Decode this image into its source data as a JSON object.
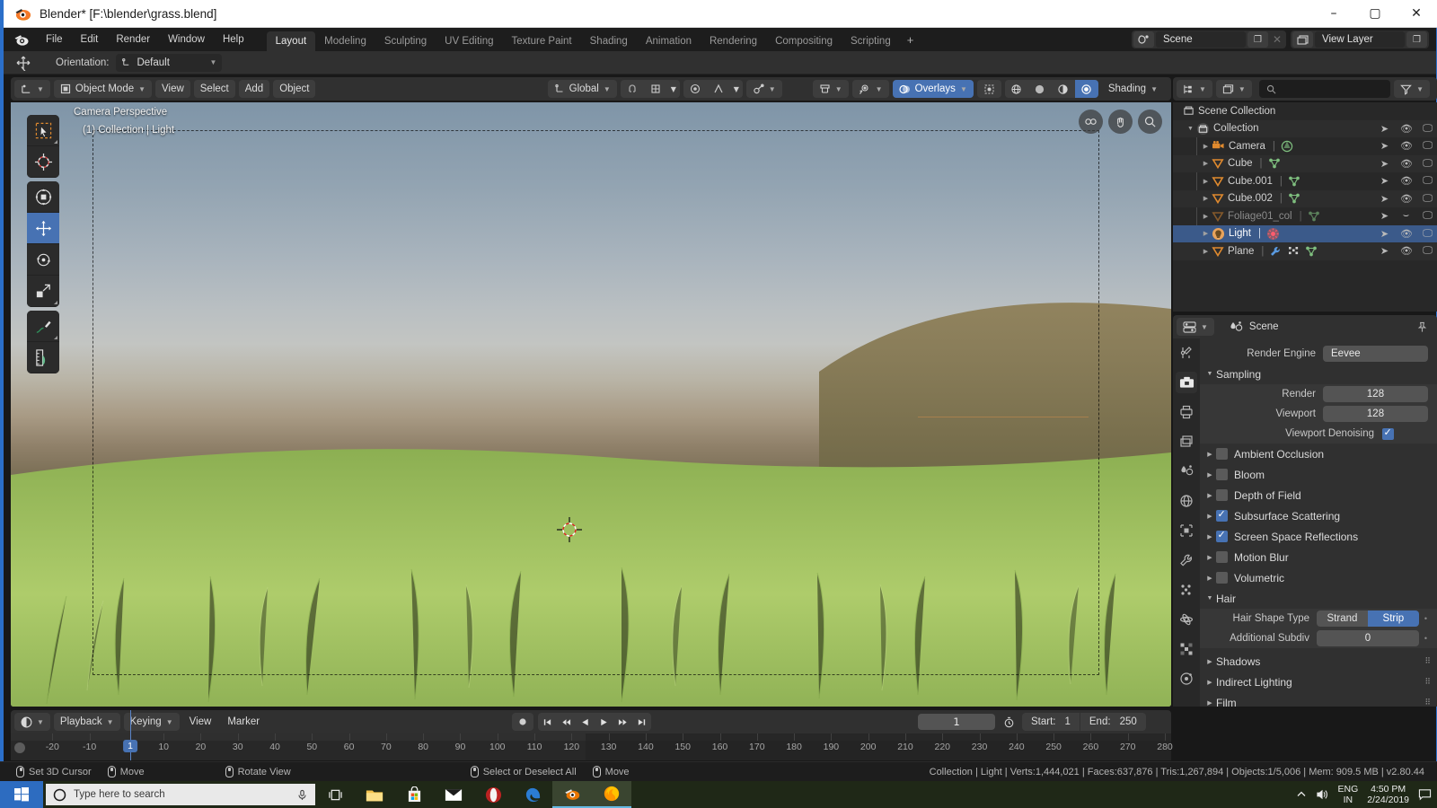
{
  "window": {
    "title": "Blender* [F:\\blender\\grass.blend]",
    "minimize": "–",
    "maximize": "▢",
    "close": "✕"
  },
  "topbar": {
    "app_icon": "blender-logo-icon",
    "menus": [
      "File",
      "Edit",
      "Render",
      "Window",
      "Help"
    ],
    "workspace_tabs": [
      {
        "label": "Layout",
        "active": true
      },
      {
        "label": "Modeling",
        "active": false
      },
      {
        "label": "Sculpting",
        "active": false
      },
      {
        "label": "UV Editing",
        "active": false
      },
      {
        "label": "Texture Paint",
        "active": false
      },
      {
        "label": "Shading",
        "active": false
      },
      {
        "label": "Animation",
        "active": false
      },
      {
        "label": "Rendering",
        "active": false
      },
      {
        "label": "Compositing",
        "active": false
      },
      {
        "label": "Scripting",
        "active": false
      },
      {
        "label": "+",
        "active": false
      }
    ],
    "scene_name": "Scene",
    "view_layer_name": "View Layer"
  },
  "tool_settings": {
    "orientation_label": "Orientation:",
    "orientation_value": "Default"
  },
  "viewport_header": {
    "mode": "Object Mode",
    "menus": [
      "View",
      "Select",
      "Add",
      "Object"
    ],
    "transform_orientation": "Global",
    "overlays": "Overlays",
    "shading": "Shading"
  },
  "viewport": {
    "label_line1": "Camera Perspective",
    "label_line2": "(1) Collection | Light",
    "tools": [
      "tweak-select-tool",
      "cursor-tool",
      "transform-tool",
      "move-tool",
      "rotate-tool",
      "scale-tool",
      "annotate-tool",
      "measure-tool"
    ],
    "gizmos": [
      "camera-gizmo",
      "hand-pan-gizmo",
      "zoom-gizmo"
    ]
  },
  "outliner": {
    "filter_icon": "filter-icon",
    "search_placeholder": "",
    "rows": [
      {
        "name": "Scene Collection",
        "icon": "collection-icon",
        "indent": 0,
        "disclose": "",
        "selected": false,
        "dim": false,
        "badges": []
      },
      {
        "name": "Collection",
        "icon": "collection-icon",
        "indent": 1,
        "disclose": "▼",
        "selected": false,
        "dim": false,
        "badges": []
      },
      {
        "name": "Camera",
        "icon": "camera-icon",
        "indent": 2,
        "disclose": "▶",
        "selected": false,
        "dim": false,
        "badges": [
          "camera-data-icon"
        ]
      },
      {
        "name": "Cube",
        "icon": "mesh-icon",
        "indent": 2,
        "disclose": "▶",
        "selected": false,
        "dim": false,
        "badges": [
          "mesh-data-icon"
        ]
      },
      {
        "name": "Cube.001",
        "icon": "mesh-icon",
        "indent": 2,
        "disclose": "▶",
        "selected": false,
        "dim": false,
        "badges": [
          "mesh-data-icon"
        ]
      },
      {
        "name": "Cube.002",
        "icon": "mesh-icon",
        "indent": 2,
        "disclose": "▶",
        "selected": false,
        "dim": false,
        "badges": [
          "mesh-data-icon"
        ]
      },
      {
        "name": "Foliage01_col",
        "icon": "mesh-icon",
        "indent": 2,
        "disclose": "▶",
        "selected": false,
        "dim": true,
        "badges": [
          "mesh-data-icon"
        ]
      },
      {
        "name": "Light",
        "icon": "light-icon",
        "indent": 2,
        "disclose": "▶",
        "selected": true,
        "dim": false,
        "badges": [
          "light-data-icon"
        ]
      },
      {
        "name": "Plane",
        "icon": "mesh-icon",
        "indent": 2,
        "disclose": "▶",
        "selected": false,
        "dim": false,
        "badges": [
          "modifier-icon",
          "particles-icon",
          "mesh-data-icon"
        ]
      }
    ]
  },
  "properties": {
    "breadcrumb": "Scene",
    "pin_icon": "pin-icon",
    "tabs": [
      "tool-tab",
      "render-tab",
      "output-tab",
      "view-layer-tab",
      "scene-tab",
      "world-tab",
      "object-tab",
      "modifier-tab",
      "particles-tab",
      "physics-tab",
      "constraint-tab",
      "data-tab"
    ],
    "render_engine_label": "Render Engine",
    "render_engine_value": "Eevee",
    "sampling": {
      "title": "Sampling",
      "render_label": "Render",
      "render_value": "128",
      "viewport_label": "Viewport",
      "viewport_value": "128",
      "denoise_label": "Viewport Denoising",
      "denoise_checked": true
    },
    "panels": [
      {
        "label": "Ambient Occlusion",
        "checked": false
      },
      {
        "label": "Bloom",
        "checked": false
      },
      {
        "label": "Depth of Field",
        "checked": false
      },
      {
        "label": "Subsurface Scattering",
        "checked": true
      },
      {
        "label": "Screen Space Reflections",
        "checked": true
      },
      {
        "label": "Motion Blur",
        "checked": false
      },
      {
        "label": "Volumetric",
        "checked": false
      }
    ],
    "hair": {
      "title": "Hair",
      "shape_type_label": "Hair Shape Type",
      "shape_options": [
        "Strand",
        "Strip"
      ],
      "shape_selected": "Strip",
      "subdiv_label": "Additional Subdiv",
      "subdiv_value": "0"
    },
    "closed_panels": [
      "Shadows",
      "Indirect Lighting",
      "Film"
    ]
  },
  "timeline": {
    "editor_icon": "timeline-icon",
    "menus": [
      "Playback",
      "Keying",
      "View",
      "Marker"
    ],
    "playback_buttons": [
      "record-icon",
      "jump-start-icon",
      "prev-keyframe-icon",
      "play-reverse-icon",
      "play-icon",
      "next-keyframe-icon",
      "jump-end-icon"
    ],
    "current_frame": "1",
    "start_label": "Start:",
    "start_value": "1",
    "end_label": "End:",
    "end_value": "250",
    "ruler_ticks": [
      -20,
      -10,
      1,
      10,
      20,
      30,
      40,
      50,
      60,
      70,
      80,
      90,
      100,
      110,
      120,
      130,
      140,
      150,
      160,
      170,
      180,
      190,
      200,
      210,
      220,
      230,
      240,
      250,
      260,
      270,
      280
    ],
    "playhead_frame": "1"
  },
  "statusbar": {
    "hints": [
      {
        "icon": "mouse-left-icon",
        "label": "Set 3D Cursor"
      },
      {
        "icon": "mouse-left-drag-icon",
        "label": "Move"
      },
      {
        "icon": "mouse-middle-icon",
        "label": "Rotate View"
      },
      {
        "icon": "mouse-right-icon",
        "label": "Select or Deselect All"
      },
      {
        "icon": "mouse-right-drag-icon",
        "label": "Move"
      }
    ],
    "stats": "Collection | Light | Verts:1,444,021 | Faces:637,876 | Tris:1,267,894 | Objects:1/5,006 | Mem: 909.5 MB | v2.80.44"
  },
  "taskbar": {
    "start_icon": "windows-start-icon",
    "search_placeholder": "Type here to search",
    "cortana_icon": "cortana-circle-icon",
    "mic_icon": "microphone-icon",
    "apps": [
      {
        "icon": "task-view-icon",
        "active": false
      },
      {
        "icon": "file-explorer-icon",
        "active": false
      },
      {
        "icon": "microsoft-store-icon",
        "active": false
      },
      {
        "icon": "mail-icon",
        "active": false
      },
      {
        "icon": "opera-icon",
        "active": false
      },
      {
        "icon": "edge-icon",
        "active": false
      },
      {
        "icon": "blender-icon",
        "active": true
      },
      {
        "icon": "firefox-icon",
        "active": true
      }
    ],
    "tray": {
      "chevron": "show-hidden-icons",
      "volume": "volume-icon",
      "lang_line1": "ENG",
      "lang_line2": "IN",
      "time": "4:50 PM",
      "date": "2/24/2019",
      "notifications": "action-center-icon"
    }
  },
  "colors": {
    "accent_blue": "#4772b3",
    "win_accent": "#2b6fc9",
    "panel_bg": "#303030",
    "editor_bg": "#282828"
  }
}
